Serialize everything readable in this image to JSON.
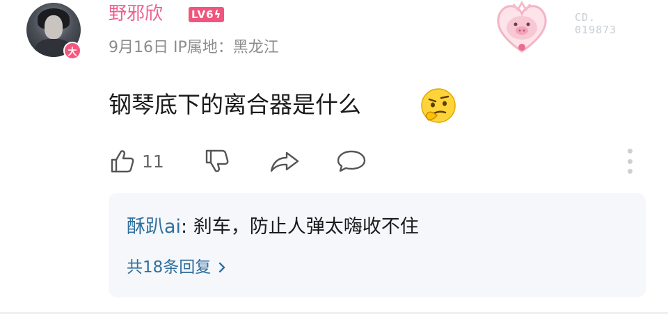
{
  "comment": {
    "username": "野邪欣",
    "level": "LV6",
    "avatar_badge": "大",
    "date": "9月16日",
    "ip_location": "IP属地：黑龙江",
    "decoration_code": [
      "CD.",
      "019873"
    ],
    "text": "钢琴底下的离合器是什么",
    "emoji": "thinking-face-emoji",
    "likes": "11",
    "icons": [
      "thumbs-up-icon",
      "thumbs-down-icon",
      "share-icon",
      "comment-icon",
      "more-icon"
    ]
  },
  "replies": {
    "first_reply": {
      "author": "酥趴ai",
      "separator": ":",
      "text": " 刹车，防止人弹太嗨收不住"
    },
    "total_label": "共18条回复"
  },
  "colors": {
    "username": "#ed5f8d",
    "level_badge": "#f0567d",
    "reply_author": "#2f6f9e",
    "reply_bg": "#f5f7fa"
  }
}
